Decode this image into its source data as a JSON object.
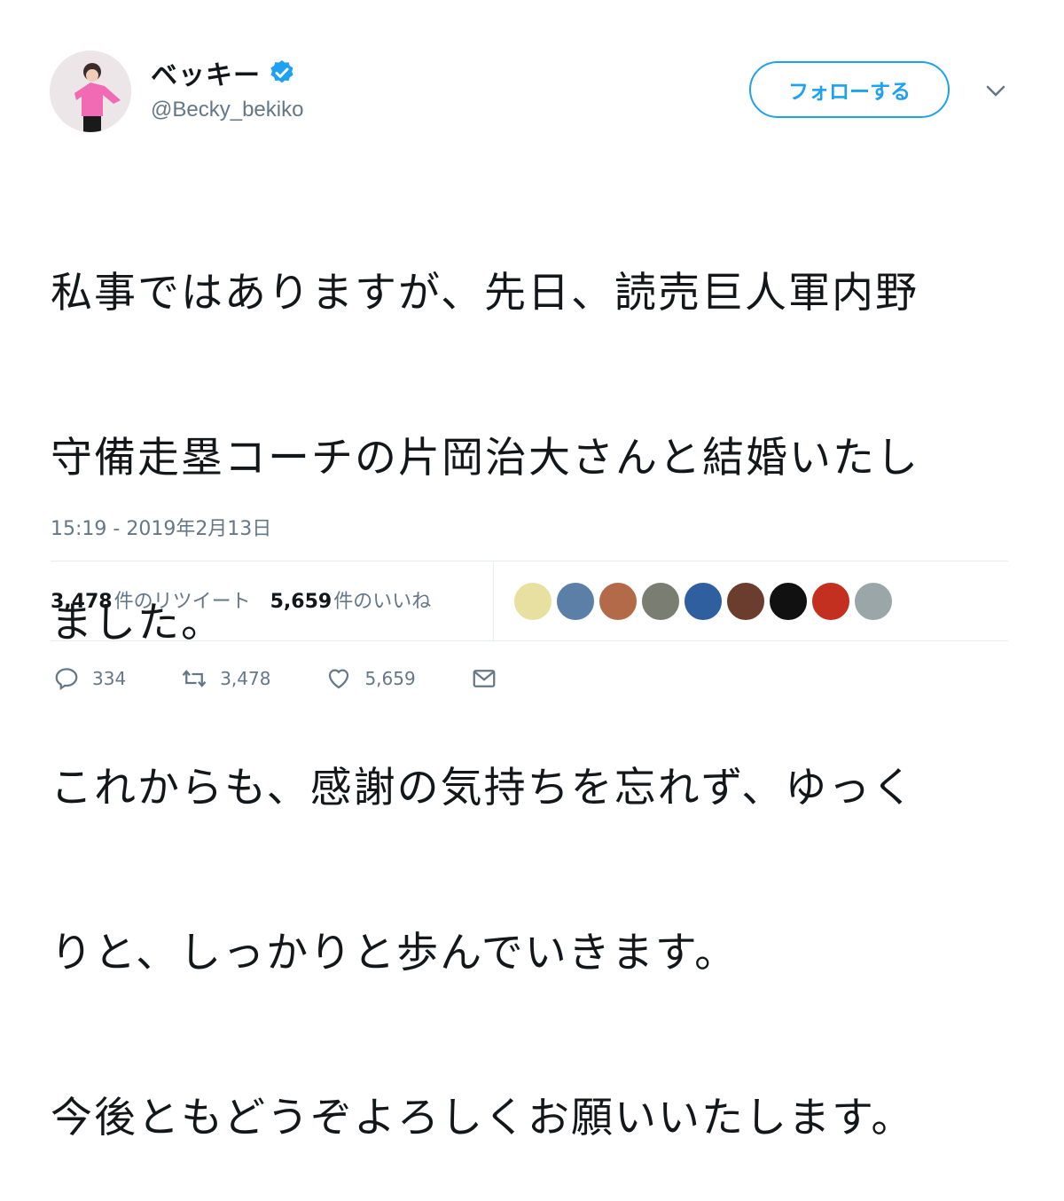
{
  "user": {
    "display_name": "ベッキー",
    "handle": "@Becky_bekiko"
  },
  "follow_button": "フォローする",
  "tweet": {
    "lines": [
      "私事ではありますが、先日、読売巨人軍内野",
      "守備走塁コーチの片岡治大さんと結婚いたし",
      "ました。",
      "これからも、感謝の気持ちを忘れず、ゆっく",
      "りと、しっかりと歩んでいきます。",
      "今後ともどうぞよろしくお願いいたします。"
    ],
    "timestamp": "15:19 - 2019年2月13日"
  },
  "stats": {
    "retweets_count": "3,478",
    "retweets_label": "件のリツイート",
    "likes_count": "5,659",
    "likes_label": "件のいいね"
  },
  "likers": [
    {
      "icon": "liker-avatar",
      "color": "#e8e0a0"
    },
    {
      "icon": "liker-avatar",
      "color": "#5b7fa6"
    },
    {
      "icon": "liker-avatar",
      "color": "#b26a48"
    },
    {
      "icon": "liker-avatar",
      "color": "#7a7d72"
    },
    {
      "icon": "liker-avatar",
      "color": "#2f5f9e"
    },
    {
      "icon": "liker-avatar",
      "color": "#6b3d2e"
    },
    {
      "icon": "liker-avatar",
      "color": "#111111"
    },
    {
      "icon": "liker-avatar",
      "color": "#c4301f"
    },
    {
      "icon": "liker-avatar",
      "color": "#9aa6a8"
    }
  ],
  "actions": {
    "reply_count": "334",
    "retweet_count": "3,478",
    "like_count": "5,659"
  },
  "colors": {
    "accent": "#1da1f2",
    "text_primary": "#14171a",
    "text_secondary": "#657786"
  }
}
